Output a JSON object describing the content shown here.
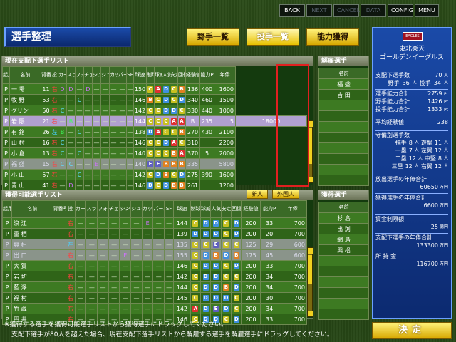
{
  "nav": [
    "BACK",
    "NEXT",
    "CANCEL",
    "DATA",
    "CONFIG",
    "MENU"
  ],
  "title": "選手整理",
  "tabs": [
    "野手一覧",
    "投手一覧",
    "能力獲得"
  ],
  "current_list": {
    "title": "現在支配下選手リスト",
    "headers": [
      "起用",
      "名前",
      "背番号",
      "投",
      "カーブ",
      "スライダー",
      "フォーク",
      "チェンジアップ",
      "シンカー",
      "シュート",
      "カット",
      "パーム",
      "SF",
      "球速",
      "制球",
      "球威",
      "人気",
      "安定",
      "回復",
      "経験値",
      "能力P",
      "年俸"
    ],
    "rows": [
      [
        "P",
        "一 場",
        "11",
        "右",
        "D",
        "D",
        "",
        "D",
        "",
        "",
        "",
        "",
        "",
        "150",
        "C",
        "A",
        "D",
        "C",
        "B",
        "136",
        "400",
        "1600"
      ],
      [
        "P",
        "牧 野",
        "53",
        "右",
        "",
        "",
        "C",
        "",
        "",
        "",
        "",
        "",
        "",
        "146",
        "B",
        "C",
        "D",
        "C",
        "D",
        "340",
        "460",
        "1500"
      ],
      [
        "P",
        "グリン",
        "50",
        "右",
        "C",
        "",
        "",
        "",
        "",
        "",
        "",
        "",
        "",
        "142",
        "C",
        "C",
        "D",
        "D",
        "C",
        "330",
        "440",
        "1000"
      ],
      [
        "P",
        "岩 隈",
        "21",
        "右",
        "",
        "B",
        "",
        "",
        "",
        "",
        "",
        "",
        "",
        "144",
        "C",
        "C",
        "C",
        "A",
        "A",
        "B",
        "235",
        "5",
        "18000"
      ],
      [
        "P",
        "有 銘",
        "26",
        "左",
        "B",
        "",
        "C",
        "",
        "",
        "",
        "",
        "",
        "",
        "138",
        "D",
        "A",
        "C",
        "C",
        "B",
        "270",
        "430",
        "2100"
      ],
      [
        "P",
        "山 村",
        "16",
        "右",
        "C",
        "",
        "",
        "",
        "",
        "",
        "",
        "",
        "",
        "146",
        "C",
        "C",
        "D",
        "A",
        "C",
        "310",
        "",
        "2200"
      ],
      [
        "P",
        "小 倉",
        "13",
        "右",
        "C",
        "",
        "C",
        "",
        "",
        "",
        "",
        "",
        "",
        "140",
        "C",
        "C",
        "C",
        "B",
        "A",
        "370",
        "5",
        "2000"
      ],
      [
        "P",
        "福 盛",
        "15",
        "右",
        "C",
        "C",
        "",
        "",
        "E",
        "",
        "",
        "",
        "",
        "140",
        "E",
        "E",
        "B",
        "B",
        "B",
        "335",
        "",
        "5800"
      ],
      [
        "P",
        "小 山",
        "57",
        "右",
        "",
        "",
        "C",
        "",
        "",
        "",
        "",
        "",
        "",
        "142",
        "C",
        "D",
        "B",
        "C",
        "D",
        "275",
        "390",
        "1600"
      ],
      [
        "P",
        "青 山",
        "41",
        "右",
        "",
        "D",
        "",
        "",
        "",
        "",
        "",
        "",
        "",
        "146",
        "D",
        "C",
        "D",
        "B",
        "B",
        "261",
        "",
        "1200"
      ]
    ]
  },
  "release_list": {
    "title": "解雇選手",
    "header": "名前",
    "names": [
      "福 盛",
      "吉 田"
    ]
  },
  "acquirable_list": {
    "title": "獲得可能選手リスト",
    "filters": [
      "新人",
      "外国人"
    ],
    "rows": [
      [
        "P",
        "浪 江",
        "",
        "右",
        "",
        "",
        "",
        "",
        "",
        "",
        "E",
        "",
        "",
        "144",
        "C",
        "D",
        "D",
        "C",
        "D",
        "200",
        "33",
        "700"
      ],
      [
        "P",
        "重 栖",
        "",
        "右",
        "",
        "",
        "",
        "",
        "",
        "",
        "",
        "",
        "",
        "139",
        "D",
        "D",
        "D",
        "C",
        "D",
        "200",
        "20",
        "700"
      ],
      [
        "P",
        "興 梠",
        "",
        "左",
        "",
        "",
        "",
        "",
        "",
        "",
        "",
        "",
        "",
        "135",
        "C",
        "C",
        "E",
        "C",
        "C",
        "125",
        "29",
        "600"
      ],
      [
        "P",
        "出 口",
        "",
        "右",
        "",
        "",
        "",
        "",
        "E",
        "",
        "",
        "",
        "",
        "155",
        "C",
        "D",
        "B",
        "D",
        "B",
        "175",
        "45",
        "600"
      ],
      [
        "P",
        "大 賀",
        "",
        "右",
        "",
        "",
        "",
        "",
        "",
        "",
        "",
        "",
        "",
        "146",
        "C",
        "D",
        "D",
        "C",
        "D",
        "200",
        "33",
        "700"
      ],
      [
        "P",
        "岩 切",
        "",
        "右",
        "",
        "",
        "",
        "",
        "",
        "",
        "",
        "",
        "",
        "142",
        "C",
        "D",
        "D",
        "C",
        "C",
        "200",
        "34",
        "700"
      ],
      [
        "P",
        "藍 澤",
        "",
        "右",
        "",
        "",
        "",
        "",
        "",
        "",
        "",
        "",
        "",
        "144",
        "C",
        "D",
        "D",
        "B",
        "D",
        "200",
        "34",
        "700"
      ],
      [
        "P",
        "福 村",
        "",
        "右",
        "",
        "",
        "",
        "",
        "",
        "",
        "",
        "",
        "",
        "145",
        "C",
        "D",
        "D",
        "D",
        "C",
        "200",
        "30",
        "700"
      ],
      [
        "P",
        "竹 蔵",
        "",
        "右",
        "",
        "",
        "",
        "",
        "",
        "",
        "",
        "",
        "",
        "142",
        "A",
        "D",
        "E",
        "D",
        "C",
        "200",
        "34",
        "700"
      ],
      [
        "P",
        "円 井",
        "",
        "右",
        "",
        "",
        "",
        "",
        "",
        "",
        "",
        "",
        "",
        "146",
        "C",
        "D",
        "D",
        "C",
        "D",
        "200",
        "33",
        "700"
      ]
    ]
  },
  "acquire_list": {
    "title": "獲得選手",
    "header": "名前",
    "names": [
      "杉 島",
      "出 渕",
      "網 島",
      "興 梠"
    ]
  },
  "team": {
    "name_top": "東北楽天",
    "name": "ゴールデンイーグルス",
    "logo": "EAGLES",
    "players_label": "支配下選手数",
    "players": "70",
    "players_unit": "人",
    "fielders_label": "野手",
    "fielders": "36",
    "fielders_unit": "人",
    "pitchers_label": "投手",
    "pitchers": "34",
    "pitchers_unit": "人",
    "total_label": "選手能力合計",
    "total": "2759",
    "total_unit": "Pt",
    "f_total_label": "野手能力合計",
    "f_total": "1426",
    "f_total_unit": "Pt",
    "p_total_label": "投手能力合計",
    "p_total": "1333",
    "p_total_unit": "Pt",
    "exp_label": "平均経験値",
    "exp": "238",
    "def_label": "守備別選手数",
    "def": [
      [
        "捕手",
        "8",
        "人",
        "遊撃",
        "11",
        "人"
      ],
      [
        "一塁",
        "7",
        "人",
        "左翼",
        "12",
        "人"
      ],
      [
        "二塁",
        "12",
        "人",
        "中堅",
        "8",
        "人"
      ],
      [
        "三塁",
        "12",
        "人",
        "右翼",
        "12",
        "人"
      ]
    ],
    "release_pay_label": "放出選手の年俸合計",
    "release_pay": "60650",
    "release_pay_unit": "万円",
    "acquire_pay_label": "獲得選手の年俸合計",
    "acquire_pay": "6600",
    "acquire_pay_unit": "万円",
    "budget_label": "資金制限額",
    "budget": "25",
    "budget_unit": "億円",
    "payroll_label": "支配下選手の年俸合計",
    "payroll": "133300",
    "payroll_unit": "万円",
    "money_label": "所 持 金",
    "money": "116700",
    "money_unit": "万円"
  },
  "decide": "決定",
  "notes": [
    "※獲得する選手を獲得可能選手リストから獲得選手にドラッグしてください。",
    "支配下選手が80人を超えた場合、現在支配下選手リストから解雇する選手を解雇選手にドラッグしてください。"
  ]
}
